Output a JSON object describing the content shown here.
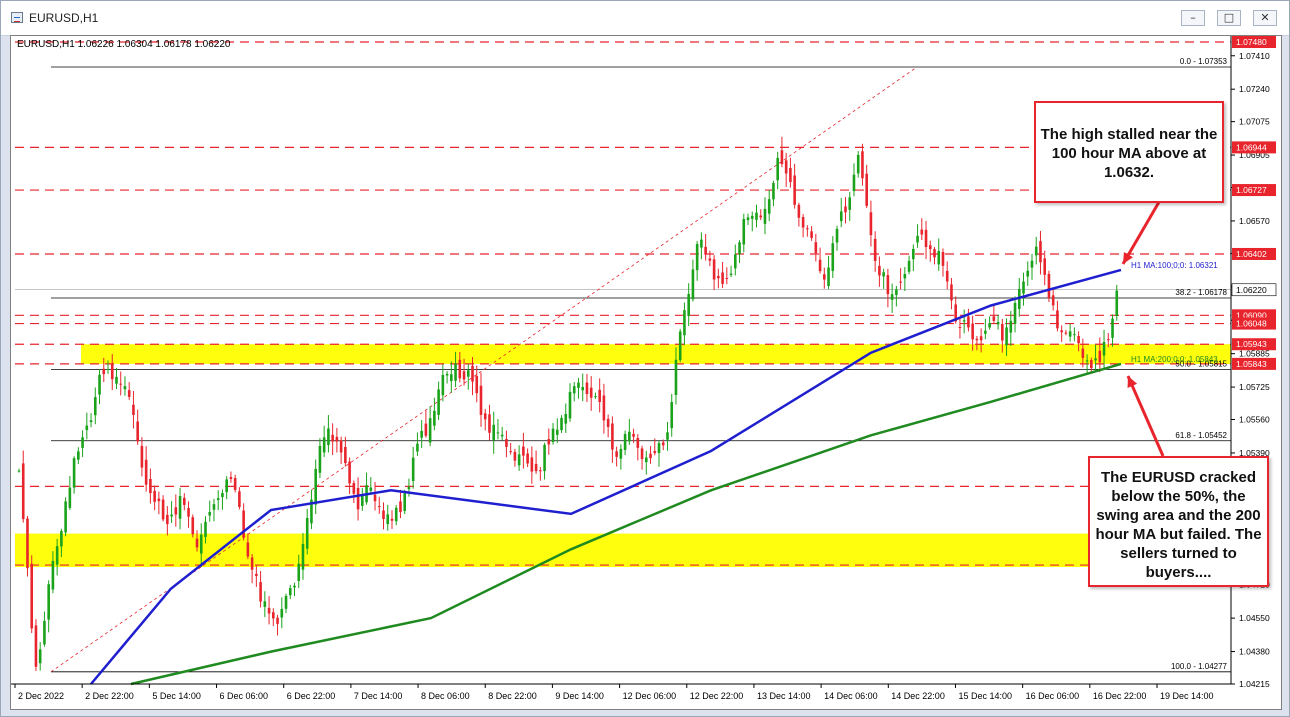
{
  "window": {
    "title": "EURUSD,H1",
    "buttons": [
      "minimize-button",
      "maximize-button",
      "close-button"
    ]
  },
  "chart_header": "EURUSD,H1  1.06226 1.06304 1.06178 1.06220",
  "colors": {
    "bull": "#1aa31a",
    "bear": "#e8242d",
    "ma100": "#1f1fd0",
    "ma200": "#1f8a1f",
    "zone": "#ffff00",
    "resistance": "#e8242d",
    "fib": "#000000"
  },
  "chart_data": {
    "type": "candlestick",
    "symbol": "EURUSD",
    "timeframe": "H1",
    "ylim": [
      1.04215,
      1.0748
    ],
    "y_ticks": [
      1.0741,
      1.0724,
      1.07075,
      1.06905,
      1.0674,
      1.0657,
      1.06405,
      1.06235,
      1.06065,
      1.05895,
      1.05725,
      1.0556,
      1.0539,
      1.0522,
      1.0505,
      1.0488,
      1.0472,
      1.0455,
      1.0438,
      1.04215
    ],
    "x_labels": [
      "2 Dec 2022",
      "2 Dec 22:00",
      "5 Dec 14:00",
      "6 Dec 06:00",
      "6 Dec 22:00",
      "7 Dec 14:00",
      "8 Dec 06:00",
      "8 Dec 22:00",
      "9 Dec 14:00",
      "12 Dec 06:00",
      "12 Dec 22:00",
      "13 Dec 14:00",
      "14 Dec 06:00",
      "14 Dec 22:00",
      "15 Dec 14:00",
      "16 Dec 06:00",
      "16 Dec 22:00",
      "19 Dec 14:00"
    ],
    "ohlc_close_path": [
      1.053,
      1.0428,
      1.0475,
      1.052,
      1.0548,
      1.0575,
      1.0582,
      1.056,
      1.052,
      1.0505,
      1.0515,
      1.0495,
      1.051,
      1.053,
      1.0495,
      1.0462,
      1.0455,
      1.047,
      1.051,
      1.0555,
      1.0535,
      1.0515,
      1.052,
      1.05,
      1.0522,
      1.0548,
      1.057,
      1.0585,
      1.0575,
      1.0555,
      1.0545,
      1.0535,
      1.053,
      1.0545,
      1.0565,
      1.0575,
      1.056,
      1.054,
      1.0548,
      1.0535,
      1.0545,
      1.06,
      1.065,
      1.063,
      1.0625,
      1.0665,
      1.0655,
      1.069,
      1.067,
      1.0645,
      1.063,
      1.066,
      1.069,
      1.064,
      1.0615,
      1.0635,
      1.065,
      1.064,
      1.061,
      1.0595,
      1.0605,
      1.06,
      1.062,
      1.0645,
      1.061,
      1.06,
      1.059,
      1.0583,
      1.0622
    ],
    "ma100_label": "H1 MA:100;0;0: 1.06321",
    "ma100_value": 1.06321,
    "ma200_label": "H1 MA:200;0;0: 1.05843",
    "ma200_value": 1.05843,
    "current_price": 1.0622,
    "fib_levels": [
      {
        "label": "0.0 - 1.07353",
        "value": 1.07353
      },
      {
        "label": "38.2 - 1.06178",
        "value": 1.06178
      },
      {
        "label": "50.0 - 1.05815",
        "value": 1.05815
      },
      {
        "label": "61.8 - 1.05452",
        "value": 1.05452
      },
      {
        "label": "100.0 - 1.04277",
        "value": 1.04277
      }
    ],
    "resistance_levels": [
      1.0748,
      1.06944,
      1.06727,
      1.06402,
      1.0609,
      1.06048,
      1.05943,
      1.05843
    ],
    "price_tags": [
      "1.07480",
      "1.06944",
      "1.06727",
      "1.06402",
      "1.06220",
      "1.06090",
      "1.06048",
      "1.05943",
      "1.05843"
    ],
    "partial_price_tags": [
      "1.05885",
      "5",
      "0",
      "6"
    ],
    "price_axis_labels": [
      "1.07410",
      "1.07240",
      "1.07075",
      "1.06905",
      "1.06570",
      "1.05725",
      "1.05560",
      "1.05390",
      "1.05",
      "1.04720",
      "1.04550",
      "1.04380",
      "1.04215"
    ],
    "swing_zones": [
      {
        "from": 1.05843,
        "to": 1.05943
      },
      {
        "from": 1.0481,
        "to": 1.0498
      }
    ]
  },
  "callouts": {
    "top": "The high stalled near the 100 hour MA above at 1.0632.",
    "bottom": "The EURUSD cracked below the 50%, the swing area and the 200 hour MA but failed. The sellers turned to buyers...."
  }
}
